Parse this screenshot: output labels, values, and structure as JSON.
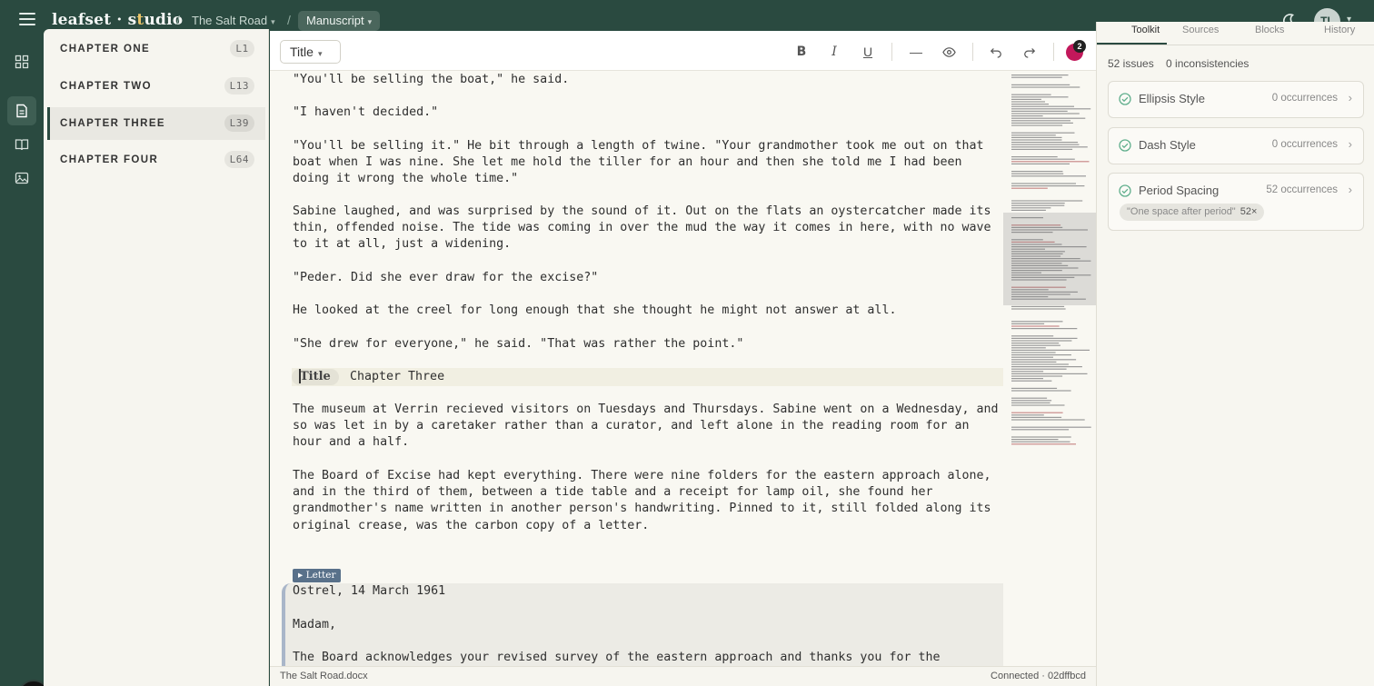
{
  "app": {
    "brand_part1": "leafset · s",
    "brand_accent": "t",
    "brand_part2": "udio",
    "breadcrumb_project": "The Salt Road",
    "breadcrumb_view": "Manuscript",
    "user_initials": "TL"
  },
  "colors": {
    "chrome": "#2a4a40",
    "accent": "#e9c46a",
    "collaborator": "#c2185b",
    "check": "#5fae8c"
  },
  "chapters": [
    {
      "label": "CHAPTER ONE",
      "line": "L1",
      "active": false
    },
    {
      "label": "CHAPTER TWO",
      "line": "L13",
      "active": false
    },
    {
      "label": "CHAPTER THREE",
      "line": "L39",
      "active": true
    },
    {
      "label": "CHAPTER FOUR",
      "line": "L64",
      "active": false
    }
  ],
  "toolbar": {
    "style_value": "Title",
    "icons": [
      "bold-icon",
      "italic-icon",
      "underline-icon",
      "divider-icon",
      "preview-eye-icon",
      "undo-icon",
      "redo-icon"
    ],
    "collaborator_count": "2"
  },
  "document": {
    "paragraphs": [
      "\"You'll be selling the boat,\" he said.",
      "\"I haven't decided.\"",
      "\"You'll be selling it.\" He bit through a length of twine. \"Your grandmother took me out on that boat when I was nine. She let me hold the tiller for an hour and then she told me I had been doing it wrong the whole time.\"",
      "Sabine laughed, and was surprised by the sound of it. Out on the flats an oystercatcher made its thin, offended noise. The tide was coming in over the mud the way it comes in here, with no wave to it at all, just a widening.",
      "\"Peder. Did she ever draw for the excise?\"",
      "He looked at the creel for long enough that she thought he might not answer at all.",
      "\"She drew for everyone,\" he said. \"That was rather the point.\""
    ],
    "title_tag": "Title",
    "title_text": "Chapter Three",
    "paragraphs_after": [
      "The museum at Verrin recieved visitors on Tuesdays and Thursdays. Sabine went on a Wednesday, and so was let in by a caretaker rather than a curator, and left alone in the reading room for an hour and a half.",
      "The Board of Excise had kept everything. There were nine folders for the eastern approach alone, and in the third of them, between a tide table and a receipt for lamp oil, she found her grandmother's name written in another person's handwriting. Pinned to it, still folded along its original crease, was the carbon copy of a letter."
    ],
    "letter_tag": "▸ Letter",
    "letter_lines": [
      "Ostrel, 14 March 1961",
      "Madam,",
      "The Board acknowledges your revised survey of the eastern approach and thanks you for the"
    ]
  },
  "status": {
    "filename": "The Salt Road.docx",
    "connection": "Connected · 02dffbcd"
  },
  "panel": {
    "tabs": [
      "Toolkit",
      "Sources",
      "Blocks",
      "History"
    ],
    "issues_count": "52 issues",
    "inconsistencies": "0 inconsistencies",
    "checks": [
      {
        "name": "Ellipsis Style",
        "count": "0 occurrences"
      },
      {
        "name": "Dash Style",
        "count": "0 occurrences"
      },
      {
        "name": "Period Spacing",
        "count": "52 occurrences",
        "chip": "\"One space after period\"",
        "chip_count": "52×"
      }
    ]
  }
}
